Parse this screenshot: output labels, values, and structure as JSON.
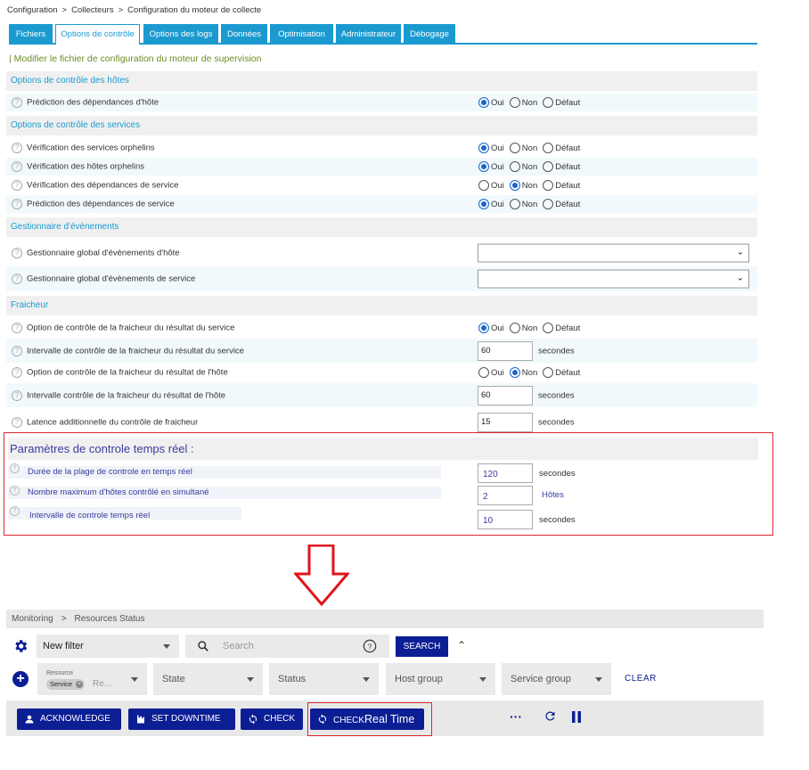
{
  "breadcrumb": [
    "Configuration",
    "Collecteurs",
    "Configuration du moteur de collecte"
  ],
  "tabs": [
    {
      "label": "Fichiers",
      "active": false
    },
    {
      "label": "Options de contrôle",
      "active": true
    },
    {
      "label": "Options des logs",
      "active": false
    },
    {
      "label": "Données",
      "active": false
    },
    {
      "label": "Optimisation",
      "active": false
    },
    {
      "label": "Administrateur",
      "active": false
    },
    {
      "label": "Débogage",
      "active": false
    }
  ],
  "form_title": "| Modifier le fichier de configuration du moteur de supervision",
  "sections": {
    "hosts": "Options de contrôle des hôtes",
    "services": "Options de contrôle des services",
    "events": "Gestionnaire d'évènements",
    "freshness": "Fraicheur"
  },
  "radio_labels": {
    "yes": "Oui",
    "no": "Non",
    "default": "Défaut"
  },
  "rows": {
    "host_dep_pred": {
      "label": "Prédiction des dépendances d'hôte",
      "value": "Oui"
    },
    "orphan_services": {
      "label": "Vérification des services orphelins",
      "value": "Oui"
    },
    "orphan_hosts": {
      "label": "Vérification des hôtes orphelins",
      "value": "Oui"
    },
    "service_dep_check": {
      "label": "Vérification des dépendances de service",
      "value": "Non"
    },
    "service_dep_pred": {
      "label": "Prédiction des dépendances de service",
      "value": "Oui"
    },
    "global_host_handler": {
      "label": "Gestionnaire global d'évènements d'hôte",
      "value": ""
    },
    "global_service_handler": {
      "label": "Gestionnaire global d'évènements de service",
      "value": ""
    },
    "service_fresh_opt": {
      "label": "Option de contrôle de la fraicheur du résultat du service",
      "value": "Oui"
    },
    "service_fresh_int": {
      "label": "Intervalle de contrôle de la fraicheur du résultat du service",
      "value": "60",
      "unit": "secondes"
    },
    "host_fresh_opt": {
      "label": "Option de contrôle de la fraicheur du résultat de l'hôte",
      "value": "Non"
    },
    "host_fresh_int": {
      "label": "Intervalle contrôle de la fraicheur du résultat de l'hôte",
      "value": "60",
      "unit": "secondes"
    },
    "fresh_latency": {
      "label": "Latence additionnelle du contrôle de fraicheur",
      "value": "15",
      "unit": "secondes"
    }
  },
  "realtime": {
    "title": "Paramètres de controle temps réel :",
    "duration": {
      "label": "Durée de la plage de controle en temps réel",
      "value": "120",
      "unit": "secondes"
    },
    "max_hosts": {
      "label": "Nombre maximum d'hôtes contrôlé en simultané",
      "value": "2",
      "unit": "Hôtes"
    },
    "interval": {
      "label": "Intervalle de controle temps réel",
      "value": "10",
      "unit": "secondes"
    }
  },
  "monitoring": {
    "breadcrumb": [
      "Monitoring",
      "Resources Status"
    ],
    "filter": "New filter",
    "search_placeholder": "Search",
    "search_button": "SEARCH",
    "resource_label": "Resource",
    "chip": "Service",
    "resource_more": "Re...",
    "state": "State",
    "status": "Status",
    "host_group": "Host group",
    "service_group": "Service group",
    "clear": "CLEAR",
    "acknowledge": "ACKNOWLEDGE",
    "set_downtime": "SET DOWNTIME",
    "check": "CHECK",
    "check_rt_a": "CHECK",
    "check_rt_b": "Real Time",
    "more": "···"
  },
  "colors": {
    "tab_blue": "#1b9ad0",
    "navy": "#0c1e94",
    "highlight_red": "#d9272e",
    "title_green": "#6b8e23"
  }
}
